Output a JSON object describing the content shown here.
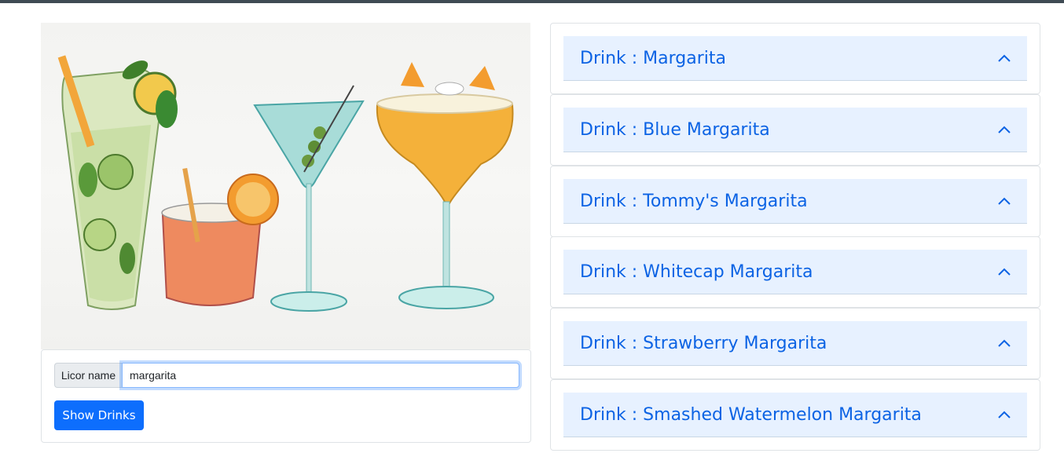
{
  "colors": {
    "topbar": "#3f4b54",
    "primary": "#0d6efd",
    "accordion_header_bg": "#e7f1ff",
    "accordion_text": "#0c63e4"
  },
  "hero": {
    "description_icon": "cocktails-watercolor-illustration"
  },
  "search": {
    "label": "Licor name",
    "value": "margarita",
    "button_label": "Show Drinks"
  },
  "drinks": [
    {
      "title": "Drink : Margarita",
      "chevron": "chevron-up-icon"
    },
    {
      "title": "Drink : Blue Margarita",
      "chevron": "chevron-up-icon"
    },
    {
      "title": "Drink : Tommy's Margarita",
      "chevron": "chevron-up-icon"
    },
    {
      "title": "Drink : Whitecap Margarita",
      "chevron": "chevron-up-icon"
    },
    {
      "title": "Drink : Strawberry Margarita",
      "chevron": "chevron-up-icon"
    },
    {
      "title": "Drink : Smashed Watermelon Margarita",
      "chevron": "chevron-up-icon"
    }
  ]
}
